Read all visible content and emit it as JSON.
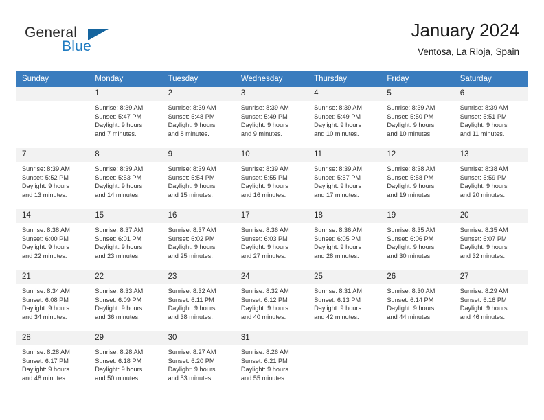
{
  "brand": {
    "name_part1": "General",
    "name_part2": "Blue",
    "triangle_color": "#15659f",
    "blue_color": "#1f7bc1"
  },
  "header": {
    "title": "January 2024",
    "subtitle": "Ventosa, La Rioja, Spain"
  },
  "theme": {
    "header_row_bg": "#3a7cbe",
    "daynum_bg": "#f2f2f2",
    "week_divider": "#3a7cbe"
  },
  "weekdays": [
    "Sunday",
    "Monday",
    "Tuesday",
    "Wednesday",
    "Thursday",
    "Friday",
    "Saturday"
  ],
  "weeks": [
    [
      {
        "day": "",
        "sunrise": "",
        "sunset": "",
        "daylight_line1": "",
        "daylight_line2": ""
      },
      {
        "day": "1",
        "sunrise": "Sunrise: 8:39 AM",
        "sunset": "Sunset: 5:47 PM",
        "daylight_line1": "Daylight: 9 hours",
        "daylight_line2": "and 7 minutes."
      },
      {
        "day": "2",
        "sunrise": "Sunrise: 8:39 AM",
        "sunset": "Sunset: 5:48 PM",
        "daylight_line1": "Daylight: 9 hours",
        "daylight_line2": "and 8 minutes."
      },
      {
        "day": "3",
        "sunrise": "Sunrise: 8:39 AM",
        "sunset": "Sunset: 5:49 PM",
        "daylight_line1": "Daylight: 9 hours",
        "daylight_line2": "and 9 minutes."
      },
      {
        "day": "4",
        "sunrise": "Sunrise: 8:39 AM",
        "sunset": "Sunset: 5:49 PM",
        "daylight_line1": "Daylight: 9 hours",
        "daylight_line2": "and 10 minutes."
      },
      {
        "day": "5",
        "sunrise": "Sunrise: 8:39 AM",
        "sunset": "Sunset: 5:50 PM",
        "daylight_line1": "Daylight: 9 hours",
        "daylight_line2": "and 10 minutes."
      },
      {
        "day": "6",
        "sunrise": "Sunrise: 8:39 AM",
        "sunset": "Sunset: 5:51 PM",
        "daylight_line1": "Daylight: 9 hours",
        "daylight_line2": "and 11 minutes."
      }
    ],
    [
      {
        "day": "7",
        "sunrise": "Sunrise: 8:39 AM",
        "sunset": "Sunset: 5:52 PM",
        "daylight_line1": "Daylight: 9 hours",
        "daylight_line2": "and 13 minutes."
      },
      {
        "day": "8",
        "sunrise": "Sunrise: 8:39 AM",
        "sunset": "Sunset: 5:53 PM",
        "daylight_line1": "Daylight: 9 hours",
        "daylight_line2": "and 14 minutes."
      },
      {
        "day": "9",
        "sunrise": "Sunrise: 8:39 AM",
        "sunset": "Sunset: 5:54 PM",
        "daylight_line1": "Daylight: 9 hours",
        "daylight_line2": "and 15 minutes."
      },
      {
        "day": "10",
        "sunrise": "Sunrise: 8:39 AM",
        "sunset": "Sunset: 5:55 PM",
        "daylight_line1": "Daylight: 9 hours",
        "daylight_line2": "and 16 minutes."
      },
      {
        "day": "11",
        "sunrise": "Sunrise: 8:39 AM",
        "sunset": "Sunset: 5:57 PM",
        "daylight_line1": "Daylight: 9 hours",
        "daylight_line2": "and 17 minutes."
      },
      {
        "day": "12",
        "sunrise": "Sunrise: 8:38 AM",
        "sunset": "Sunset: 5:58 PM",
        "daylight_line1": "Daylight: 9 hours",
        "daylight_line2": "and 19 minutes."
      },
      {
        "day": "13",
        "sunrise": "Sunrise: 8:38 AM",
        "sunset": "Sunset: 5:59 PM",
        "daylight_line1": "Daylight: 9 hours",
        "daylight_line2": "and 20 minutes."
      }
    ],
    [
      {
        "day": "14",
        "sunrise": "Sunrise: 8:38 AM",
        "sunset": "Sunset: 6:00 PM",
        "daylight_line1": "Daylight: 9 hours",
        "daylight_line2": "and 22 minutes."
      },
      {
        "day": "15",
        "sunrise": "Sunrise: 8:37 AM",
        "sunset": "Sunset: 6:01 PM",
        "daylight_line1": "Daylight: 9 hours",
        "daylight_line2": "and 23 minutes."
      },
      {
        "day": "16",
        "sunrise": "Sunrise: 8:37 AM",
        "sunset": "Sunset: 6:02 PM",
        "daylight_line1": "Daylight: 9 hours",
        "daylight_line2": "and 25 minutes."
      },
      {
        "day": "17",
        "sunrise": "Sunrise: 8:36 AM",
        "sunset": "Sunset: 6:03 PM",
        "daylight_line1": "Daylight: 9 hours",
        "daylight_line2": "and 27 minutes."
      },
      {
        "day": "18",
        "sunrise": "Sunrise: 8:36 AM",
        "sunset": "Sunset: 6:05 PM",
        "daylight_line1": "Daylight: 9 hours",
        "daylight_line2": "and 28 minutes."
      },
      {
        "day": "19",
        "sunrise": "Sunrise: 8:35 AM",
        "sunset": "Sunset: 6:06 PM",
        "daylight_line1": "Daylight: 9 hours",
        "daylight_line2": "and 30 minutes."
      },
      {
        "day": "20",
        "sunrise": "Sunrise: 8:35 AM",
        "sunset": "Sunset: 6:07 PM",
        "daylight_line1": "Daylight: 9 hours",
        "daylight_line2": "and 32 minutes."
      }
    ],
    [
      {
        "day": "21",
        "sunrise": "Sunrise: 8:34 AM",
        "sunset": "Sunset: 6:08 PM",
        "daylight_line1": "Daylight: 9 hours",
        "daylight_line2": "and 34 minutes."
      },
      {
        "day": "22",
        "sunrise": "Sunrise: 8:33 AM",
        "sunset": "Sunset: 6:09 PM",
        "daylight_line1": "Daylight: 9 hours",
        "daylight_line2": "and 36 minutes."
      },
      {
        "day": "23",
        "sunrise": "Sunrise: 8:32 AM",
        "sunset": "Sunset: 6:11 PM",
        "daylight_line1": "Daylight: 9 hours",
        "daylight_line2": "and 38 minutes."
      },
      {
        "day": "24",
        "sunrise": "Sunrise: 8:32 AM",
        "sunset": "Sunset: 6:12 PM",
        "daylight_line1": "Daylight: 9 hours",
        "daylight_line2": "and 40 minutes."
      },
      {
        "day": "25",
        "sunrise": "Sunrise: 8:31 AM",
        "sunset": "Sunset: 6:13 PM",
        "daylight_line1": "Daylight: 9 hours",
        "daylight_line2": "and 42 minutes."
      },
      {
        "day": "26",
        "sunrise": "Sunrise: 8:30 AM",
        "sunset": "Sunset: 6:14 PM",
        "daylight_line1": "Daylight: 9 hours",
        "daylight_line2": "and 44 minutes."
      },
      {
        "day": "27",
        "sunrise": "Sunrise: 8:29 AM",
        "sunset": "Sunset: 6:16 PM",
        "daylight_line1": "Daylight: 9 hours",
        "daylight_line2": "and 46 minutes."
      }
    ],
    [
      {
        "day": "28",
        "sunrise": "Sunrise: 8:28 AM",
        "sunset": "Sunset: 6:17 PM",
        "daylight_line1": "Daylight: 9 hours",
        "daylight_line2": "and 48 minutes."
      },
      {
        "day": "29",
        "sunrise": "Sunrise: 8:28 AM",
        "sunset": "Sunset: 6:18 PM",
        "daylight_line1": "Daylight: 9 hours",
        "daylight_line2": "and 50 minutes."
      },
      {
        "day": "30",
        "sunrise": "Sunrise: 8:27 AM",
        "sunset": "Sunset: 6:20 PM",
        "daylight_line1": "Daylight: 9 hours",
        "daylight_line2": "and 53 minutes."
      },
      {
        "day": "31",
        "sunrise": "Sunrise: 8:26 AM",
        "sunset": "Sunset: 6:21 PM",
        "daylight_line1": "Daylight: 9 hours",
        "daylight_line2": "and 55 minutes."
      },
      {
        "day": "",
        "sunrise": "",
        "sunset": "",
        "daylight_line1": "",
        "daylight_line2": ""
      },
      {
        "day": "",
        "sunrise": "",
        "sunset": "",
        "daylight_line1": "",
        "daylight_line2": ""
      },
      {
        "day": "",
        "sunrise": "",
        "sunset": "",
        "daylight_line1": "",
        "daylight_line2": ""
      }
    ]
  ]
}
